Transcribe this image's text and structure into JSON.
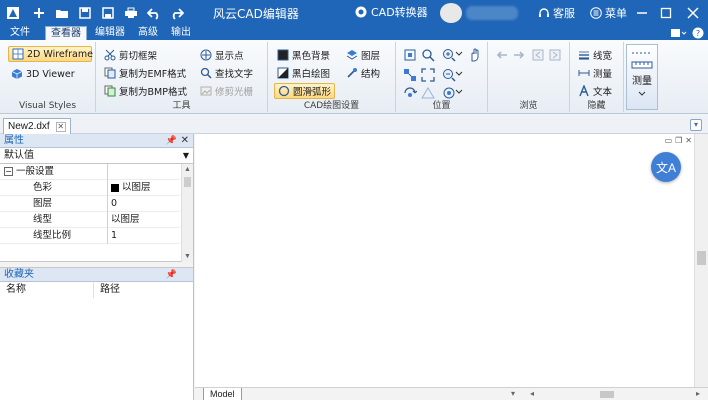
{
  "window": {
    "title": "风云CAD编辑器",
    "converter_label": "CAD转换器",
    "service_label": "客服",
    "menu_label": "菜单"
  },
  "tabs": [
    {
      "label": "文件"
    },
    {
      "label": "查看器",
      "active": true
    },
    {
      "label": "编辑器"
    },
    {
      "label": "高级"
    },
    {
      "label": "输出"
    }
  ],
  "ribbon": {
    "visual_styles": {
      "label": "Visual Styles",
      "items": [
        "2D Wireframe",
        "3D Viewer"
      ]
    },
    "tools": {
      "label": "工具",
      "items": [
        "剪切框架",
        "复制为EMF格式",
        "复制为BMP格式",
        "显示点",
        "查找文字",
        "修剪光栅"
      ]
    },
    "cad_settings": {
      "label": "CAD绘图设置",
      "items": [
        "黑色背景",
        "黑白绘图",
        "圆滑弧形",
        "图层",
        "结构"
      ]
    },
    "position": {
      "label": "位置"
    },
    "browse": {
      "label": "浏览"
    },
    "hide": {
      "label": "隐藏",
      "items": [
        "线宽",
        "测量",
        "文本"
      ]
    },
    "measure": {
      "label": "测量"
    }
  },
  "document_tab": {
    "label": "New2.dxf"
  },
  "properties_panel": {
    "title": "属性",
    "selected_value": "默认值",
    "category": "一般设置",
    "rows": [
      {
        "key": "色彩",
        "value": "以图层"
      },
      {
        "key": "图层",
        "value": "0"
      },
      {
        "key": "线型",
        "value": "以图层"
      },
      {
        "key": "线型比例",
        "value": "1"
      }
    ]
  },
  "favorites_panel": {
    "title": "收藏夹",
    "columns": [
      "名称",
      "路径"
    ]
  },
  "canvas": {
    "model_tab": "Model",
    "translate_icon_text": "文A"
  },
  "colors": {
    "titlebar": "#1f66b8",
    "accent_highlight": "#ffd780",
    "translate_button": "#3f7fd6"
  }
}
